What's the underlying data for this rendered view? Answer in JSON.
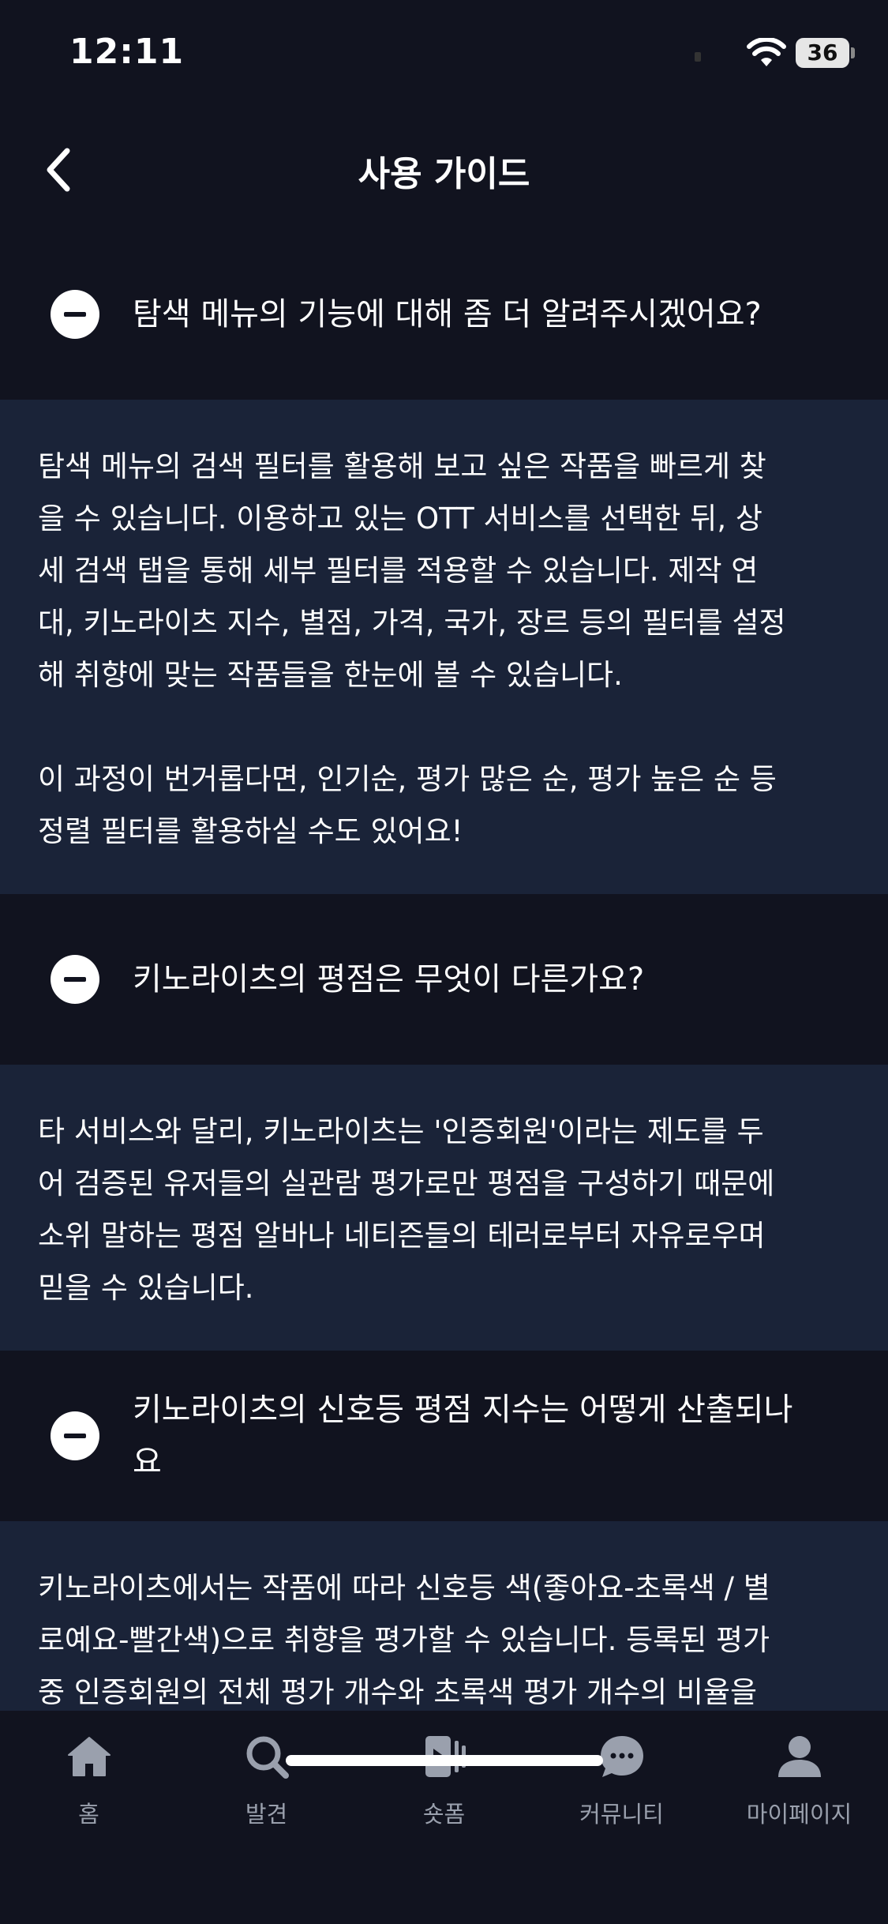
{
  "status_bar": {
    "time": "12:11",
    "battery": "36"
  },
  "header": {
    "title": "사용 가이드"
  },
  "faq": [
    {
      "question": "탐색 메뉴의 기능에 대해 좀 더 알려주시겠어요?",
      "answer": "탐색 메뉴의 검색 필터를 활용해 보고 싶은 작품을 빠르게 찾\n을 수 있습니다. 이용하고 있는 OTT 서비스를 선택한 뒤, 상\n세 검색 탭을 통해 세부 필터를 적용할 수 있습니다. 제작 연\n대, 키노라이츠 지수, 별점, 가격, 국가, 장르 등의 필터를 설정\n해 취향에 맞는 작품들을 한눈에 볼 수 있습니다.\n\n이 과정이 번거롭다면, 인기순, 평가 많은 순, 평가 높은 순 등\n정렬 필터를 활용하실 수도 있어요!"
    },
    {
      "question": "키노라이츠의 평점은 무엇이 다른가요?",
      "answer": "타 서비스와 달리, 키노라이츠는 '인증회원'이라는 제도를 두\n어 검증된 유저들의 실관람 평가로만 평점을 구성하기 때문에\n소위 말하는 평점 알바나 네티즌들의 테러로부터 자유로우며\n믿을 수 있습니다."
    },
    {
      "question": "키노라이츠의 신호등 평점 지수는 어떻게 산출되나\n요",
      "answer": "키노라이츠에서는 작품에 따라 신호등 색(좋아요-초록색 / 별\n로예요-빨간색)으로 취향을 평가할 수 있습니다. 등록된 평가\n중 인증회원의 전체 평가 개수와 초록색 평가 개수의 비율을"
    }
  ],
  "tabs": [
    {
      "label": "홈",
      "icon": "home-icon"
    },
    {
      "label": "발견",
      "icon": "search-icon"
    },
    {
      "label": "숏폼",
      "icon": "shortform-icon"
    },
    {
      "label": "커뮤니티",
      "icon": "chat-icon"
    },
    {
      "label": "마이페이지",
      "icon": "user-icon"
    }
  ],
  "colors": {
    "background": "#11131f",
    "answer_background": "#1a2338",
    "tab_inactive": "#9aa0ad"
  }
}
